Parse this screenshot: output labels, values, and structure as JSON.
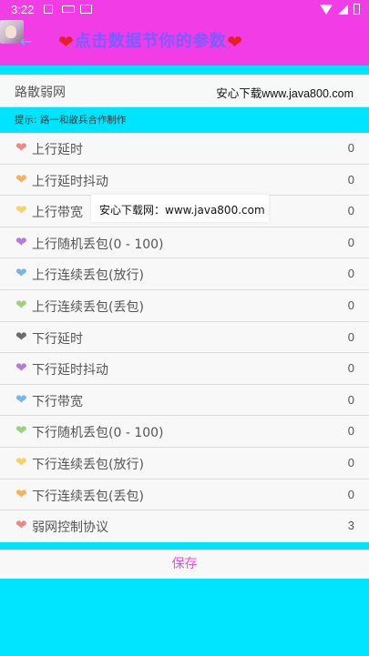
{
  "status_bar": {
    "time": "3:22"
  },
  "toolbar": {
    "title": "点击数据节你的参数"
  },
  "preset": {
    "label": "路散弱网",
    "value": "安心下载www.java800.com"
  },
  "tip": {
    "text": "提示: 路一和散兵合作制作"
  },
  "watermark": {
    "text": "安心下载网：www.java800.com"
  },
  "rows": [
    {
      "label": "上行延时",
      "value": "0",
      "heart_color": "#EC8A8A"
    },
    {
      "label": "上行延时抖动",
      "value": "0",
      "heart_color": "#F5B25D"
    },
    {
      "label": "上行带宽",
      "value": "0",
      "heart_color": "#F5D26A"
    },
    {
      "label": "上行随机丢包(0 - 100)",
      "value": "0",
      "heart_color": "#B57CD6"
    },
    {
      "label": "上行连续丢包(放行)",
      "value": "0",
      "heart_color": "#7BB4E6"
    },
    {
      "label": "上行连续丢包(丢包)",
      "value": "0",
      "heart_color": "#9ED17F"
    },
    {
      "label": "下行延时",
      "value": "0",
      "heart_color": "#6B6B6B"
    },
    {
      "label": "下行延时抖动",
      "value": "0",
      "heart_color": "#B57CD6"
    },
    {
      "label": "下行带宽",
      "value": "0",
      "heart_color": "#7BB4E6"
    },
    {
      "label": "下行随机丢包(0 - 100)",
      "value": "0",
      "heart_color": "#9ED17F"
    },
    {
      "label": "下行连续丢包(放行)",
      "value": "0",
      "heart_color": "#F5D26A"
    },
    {
      "label": "下行连续丢包(丢包)",
      "value": "0",
      "heart_color": "#F5B25D"
    },
    {
      "label": "弱网控制协议",
      "value": "3",
      "heart_color": "#EC8A8A"
    }
  ],
  "save_button": {
    "label": "保存"
  },
  "colors": {
    "toolbar": "#F23CE6",
    "background": "#00E5FF",
    "save_text": "#E552D8"
  }
}
